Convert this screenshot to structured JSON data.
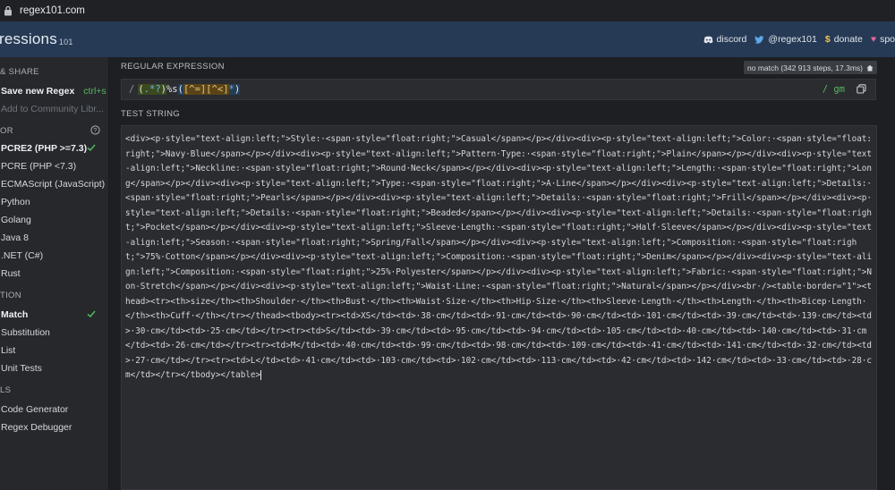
{
  "browser": {
    "url": "regex101.com"
  },
  "header": {
    "brand": "ressions",
    "brand_version": "101",
    "links": {
      "discord": "discord",
      "twitter": "@regex101",
      "donate": "donate",
      "sponsor": "spo"
    }
  },
  "sidebar": {
    "save_share_heading": "& SHARE",
    "save_button": "Save new Regex",
    "save_shortcut": "ctrl+s",
    "add_community": "Add to Community Libr...",
    "flavor_heading": "OR",
    "flavors": [
      "PCRE2 (PHP >=7.3)",
      "PCRE (PHP <7.3)",
      "ECMAScript (JavaScript)",
      "Python",
      "Golang",
      "Java 8",
      ".NET (C#)",
      "Rust"
    ],
    "function_heading": "TION",
    "functions": [
      "Match",
      "Substitution",
      "List",
      "Unit Tests"
    ],
    "tools_heading": "LS",
    "tools": [
      "Code Generator",
      "Regex Debugger"
    ]
  },
  "regex": {
    "label": "REGULAR EXPRESSION",
    "status": "no match (342 913 steps, 17.3ms)",
    "delimiter": "/",
    "tokens": {
      "g1_open": "(",
      "g1_dot": ".",
      "g1_star": "*",
      "g1_q": "?",
      "g1_close": ")",
      "lit": "%s",
      "g2_open": "(",
      "cls1": "[^=]",
      "cls2": "[^<]",
      "g2_star": "*",
      "g2_close": ")"
    },
    "flags": "/ gm"
  },
  "test_string": {
    "label": "TEST STRING",
    "content": "<div><p·style=\"text-align:left;\">Style:·<span·style=\"float:right;\">Casual</span></p></div><div><p·style=\"text-align:left;\">Color:·<span·style=\"float:right;\">Navy·Blue</span></p></div><div><p·style=\"text-align:left;\">Pattern·Type:·<span·style=\"float:right;\">Plain</span></p></div><div><p·style=\"text-align:left;\">Neckline:·<span·style=\"float:right;\">Round·Neck</span></p></div><div><p·style=\"text-align:left;\">Length:·<span·style=\"float:right;\">Long</span></p></div><div><p·style=\"text-align:left;\">Type:·<span·style=\"float:right;\">A·Line</span></p></div><div><p·style=\"text-align:left;\">Details:·<span·style=\"float:right;\">Pearls</span></p></div><div><p·style=\"text-align:left;\">Details:·<span·style=\"float:right;\">Frill</span></p></div><div><p·style=\"text-align:left;\">Details:·<span·style=\"float:right;\">Beaded</span></p></div><div><p·style=\"text-align:left;\">Details:·<span·style=\"float:right;\">Pocket</span></p></div><div><p·style=\"text-align:left;\">Sleeve·Length:·<span·style=\"float:right;\">Half·Sleeve</span></p></div><div><p·style=\"text-align:left;\">Season:·<span·style=\"float:right;\">Spring/Fall</span></p></div><div><p·style=\"text-align:left;\">Composition:·<span·style=\"float:right;\">75%·Cotton</span></p></div><div><p·style=\"text-align:left;\">Composition:·<span·style=\"float:right;\">Denim</span></p></div><div><p·style=\"text-align:left;\">Composition:·<span·style=\"float:right;\">25%·Polyester</span></p></div><div><p·style=\"text-align:left;\">Fabric:·<span·style=\"float:right;\">Non-Stretch</span></p></div><div><p·style=\"text-align:left;\">Waist·Line:·<span·style=\"float:right;\">Natural</span></p></div><br·/><table·border=\"1\"><thead><tr><th>size</th><th>Shoulder·</th><th>Bust·</th><th>Waist·Size·</th><th>Hip·Size·</th><th>Sleeve·Length·</th><th>Length·</th><th>Bicep·Length·</th><th>Cuff·</th></tr></thead><tbody><tr><td>XS</td><td>·38·cm</td><td>·91·cm</td><td>·90·cm</td><td>·101·cm</td><td>·39·cm</td><td>·139·cm</td><td>·30·cm</td><td>·25·cm</td></tr><tr><td>S</td><td>·39·cm</td><td>·95·cm</td><td>·94·cm</td><td>·105·cm</td><td>·40·cm</td><td>·140·cm</td><td>·31·cm</td><td>·26·cm</td></tr><tr><td>M</td><td>·40·cm</td><td>·99·cm</td><td>·98·cm</td><td>·109·cm</td><td>·41·cm</td><td>·141·cm</td><td>·32·cm</td><td>·27·cm</td></tr><tr><td>L</td><td>·41·cm</td><td>·103·cm</td><td>·102·cm</td><td>·113·cm</td><td>·42·cm</td><td>·142·cm</td><td>·33·cm</td><td>·28·cm</td></tr></tbody></table>"
  },
  "colors": {
    "header_bg": "#263a55",
    "accent_green": "#57b85d",
    "group_bg": "#3b4a1e",
    "class_bg": "#5a4417"
  }
}
